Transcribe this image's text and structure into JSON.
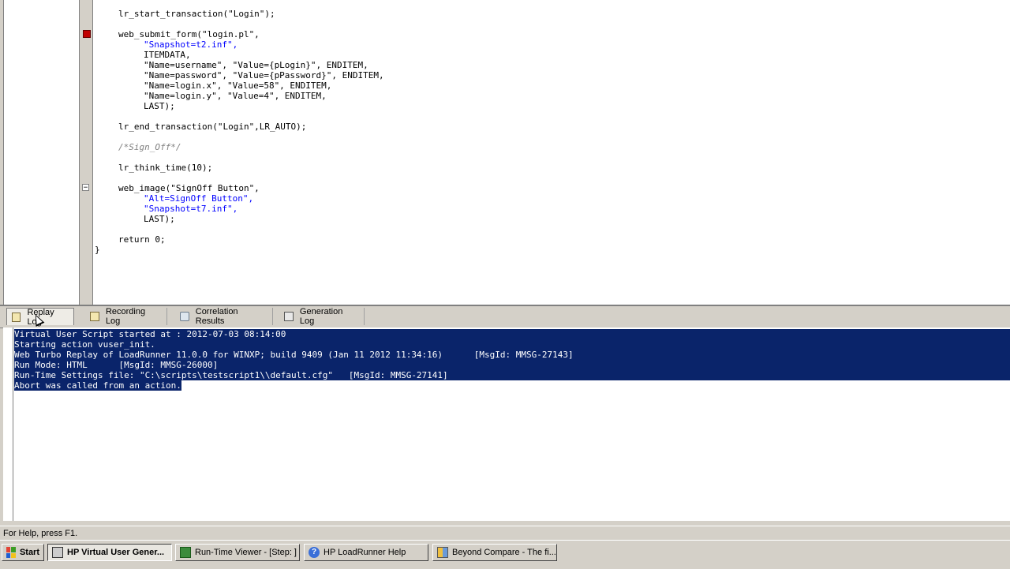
{
  "editor": {
    "lines": [
      {
        "indent": 2,
        "text": "lr_start_transaction(\"Login\");"
      },
      {
        "indent": 2,
        "text": "web_submit_form(\"login.pl\","
      },
      {
        "indent": 3,
        "text": "\"Snapshot=t2.inf\","
      },
      {
        "indent": 3,
        "text": "ITEMDATA,"
      },
      {
        "indent": 3,
        "text": "\"Name=username\", \"Value={pLogin}\", ENDITEM,"
      },
      {
        "indent": 3,
        "text": "\"Name=password\", \"Value={pPassword}\", ENDITEM,"
      },
      {
        "indent": 3,
        "text": "\"Name=login.x\", \"Value=58\", ENDITEM,"
      },
      {
        "indent": 3,
        "text": "\"Name=login.y\", \"Value=4\", ENDITEM,"
      },
      {
        "indent": 3,
        "text": "LAST);"
      },
      {
        "indent": 2,
        "text": "lr_end_transaction(\"Login\",LR_AUTO);"
      },
      {
        "indent": 2,
        "text": "/*Sign_Off*/"
      },
      {
        "indent": 2,
        "text": "lr_think_time(10);"
      },
      {
        "indent": 2,
        "text": "web_image(\"SignOff Button\","
      },
      {
        "indent": 3,
        "text": "\"Alt=SignOff Button\","
      },
      {
        "indent": 3,
        "text": "\"Snapshot=t7.inf\","
      },
      {
        "indent": 3,
        "text": "LAST);"
      },
      {
        "indent": 2,
        "text": "return 0;"
      },
      {
        "indent": 0,
        "text": "}"
      }
    ]
  },
  "log_tabs": [
    {
      "label": "Replay Log",
      "icon": "replay-log-icon",
      "active": true
    },
    {
      "label": "Recording Log",
      "icon": "recording-log-icon",
      "active": false
    },
    {
      "label": "Correlation Results",
      "icon": "correlation-results-icon",
      "active": false
    },
    {
      "label": "Generation Log",
      "icon": "generation-log-icon",
      "active": false
    }
  ],
  "log_lines": [
    "Virtual User Script started at : 2012-07-03 08:14:00",
    "Starting action vuser_init.",
    "Web Turbo Replay of LoadRunner 11.0.0 for WINXP; build 9409 (Jan 11 2012 11:34:16)      [MsgId: MMSG-27143]",
    "Run Mode: HTML      [MsgId: MMSG-26000]",
    "Run-Time Settings file: \"C:\\scripts\\testscript1\\\\default.cfg\"   [MsgId: MMSG-27141]",
    "Abort was called from an action."
  ],
  "status": {
    "text": "For Help, press F1."
  },
  "taskbar": {
    "start_label": "Start",
    "items": [
      {
        "label": "HP Virtual User Gener...",
        "icon": "vugen-icon",
        "active": true
      },
      {
        "label": "Run-Time Viewer - [Step: ]",
        "icon": "runtime-viewer-icon",
        "active": false
      },
      {
        "label": "HP LoadRunner Help",
        "icon": "help-icon",
        "active": false
      },
      {
        "label": "Beyond Compare - The fi...",
        "icon": "beyond-compare-icon",
        "active": false
      }
    ]
  },
  "colors": {
    "selection": "#0a246a",
    "string": "#0000ff",
    "param": "#800080",
    "breakpoint": "#c00000"
  }
}
